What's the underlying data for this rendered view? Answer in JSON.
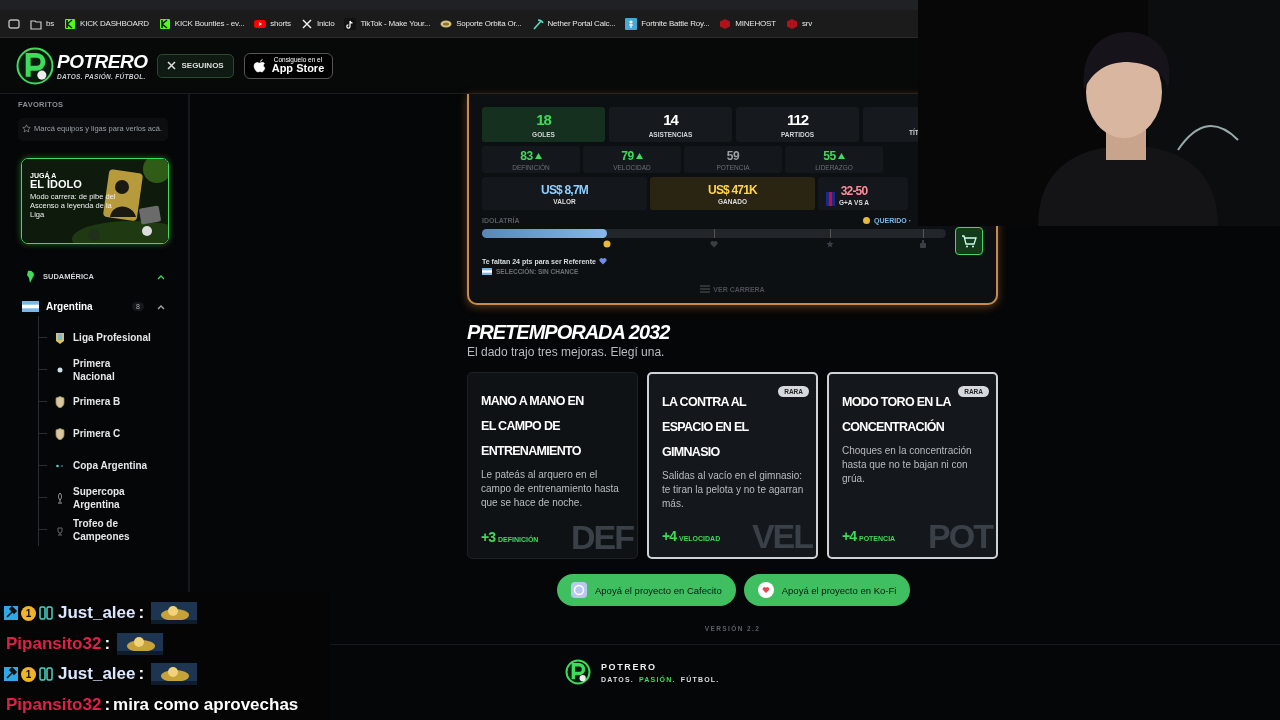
{
  "browser": {
    "bookmarks": [
      {
        "label": "bs"
      },
      {
        "label": "KICK DASHBOARD"
      },
      {
        "label": "KICK Bounties - ev..."
      },
      {
        "label": "shorts"
      },
      {
        "label": "Inicio"
      },
      {
        "label": "TikTok - Make Your..."
      },
      {
        "label": "Soporte Orbita Or..."
      },
      {
        "label": "Nether Portal Calc..."
      },
      {
        "label": "Fortnite Battle Roy..."
      },
      {
        "label": "MINEHOST"
      },
      {
        "label": "srv"
      }
    ]
  },
  "header": {
    "logo": {
      "name": "POTRERO",
      "tagline": "DATOS. PASIÓN. FÚTBOL."
    },
    "follow_button": "SEGUINOS",
    "app_store": {
      "small": "Consiguelo en el",
      "big": "App Store"
    }
  },
  "sidebar": {
    "favorites": {
      "title": "FAVORITOS",
      "hint": "Marcá equipos y ligas para verlos acá."
    },
    "promo": {
      "kicker": "JUGÁ A",
      "title": "EL ÍDOLO",
      "text": "Modo carrera: de pibe del Ascenso a leyenda de la Liga"
    },
    "regions": [
      {
        "name": "SUDAMÉRICA",
        "expanded": true,
        "children": [
          {
            "name": "Argentina",
            "count": "8",
            "expanded": true,
            "children": [
              {
                "name": "Liga Profesional"
              },
              {
                "name": "Primera Nacional"
              },
              {
                "name": "Primera B"
              },
              {
                "name": "Primera C"
              },
              {
                "name": "Copa Argentina"
              },
              {
                "name": "Supercopa Argentina"
              },
              {
                "name": "Trofeo de Campeones"
              }
            ]
          }
        ]
      }
    ]
  },
  "career": {
    "stats": [
      {
        "value": "18",
        "label": "GOLES",
        "highlighted": true
      },
      {
        "value": "14",
        "label": "ASISTENCIAS",
        "highlighted": false
      },
      {
        "value": "112",
        "label": "PARTIDOS",
        "highlighted": false
      },
      {
        "label": "TÍT",
        "highlighted": false
      }
    ],
    "attributes": [
      {
        "value": "83",
        "label": "DEFINICIÓN",
        "rising": true
      },
      {
        "value": "79",
        "label": "VELOCIDAD",
        "rising": true
      },
      {
        "value": "59",
        "label": "POTENCIA",
        "rising": false
      },
      {
        "value": "55",
        "label": "LIDERAZGO",
        "rising": true
      }
    ],
    "money": [
      {
        "value": "US$ 8,7M",
        "label": "VALOR"
      },
      {
        "value": "US$ 471K",
        "label": "GANADO"
      },
      {
        "value": "32-50",
        "label": "G+A VS A"
      }
    ],
    "idolatry": {
      "label": "IDOLATRÍA",
      "status": "QUERIDO ·",
      "level": 0.27
    },
    "next_level": "Te faltan 24 pts para ser Referente",
    "selection": "SELECCIÓN: SIN CHANCE",
    "link": "VER CARRERA"
  },
  "preseason": {
    "title": "PRETEMPORADA 2032",
    "subtitle": "El dado trajo tres mejoras. Elegí una.",
    "options": [
      {
        "title": "MANO A MANO EN EL CAMPO DE ENTRENAMIENTO",
        "rare": false,
        "text": "Le pateás al arquero en el campo de entrenamiento hasta que se hace de noche.",
        "bonus": "+3",
        "stat": "DEFINICIÓN",
        "watermark": "DEF"
      },
      {
        "title": "LA CONTRA AL ESPACIO EN EL GIMNASIO",
        "rare": true,
        "badge": "RARA",
        "text": "Salidas al vacío en el gimnasio: te tiran la pelota y no te agarran más.",
        "bonus": "+4",
        "stat": "VELOCIDAD",
        "watermark": "VEL"
      },
      {
        "title": "MODO TORO EN LA CONCENTRACIÓN",
        "rare": true,
        "badge": "RARA",
        "text": "Choques en la concentración hasta que no te bajan ni con grúa.",
        "bonus": "+4",
        "stat": "POTENCIA",
        "watermark": "POT"
      }
    ]
  },
  "support_buttons": [
    {
      "label": "Apoyá el proyecto en Cafecito"
    },
    {
      "label": "Apoyá el proyecto en Ko-Fi"
    }
  ],
  "version": "VERSIÓN 2.2",
  "footer": {
    "name": "POTRERO",
    "tagline": [
      {
        "text": "DATOS.",
        "accent": false
      },
      {
        "text": "PASIÓN.",
        "accent": true
      },
      {
        "text": "FÚTBOL.",
        "accent": false
      }
    ]
  },
  "stream": {
    "chat": [
      {
        "user": "Just_alee",
        "color": "#dce6ff",
        "badges": [
          {
            "kind": "mod"
          },
          {
            "kind": "tier",
            "label": "1"
          },
          {
            "kind": "gg"
          }
        ],
        "colon": ":",
        "kind": "emote"
      },
      {
        "user": "Pipansito32",
        "color": "#e0204a",
        "colon": ":",
        "kind": "emote"
      },
      {
        "user": "Just_alee",
        "color": "#dce6ff",
        "badges": [
          {
            "kind": "mod"
          },
          {
            "kind": "tier",
            "label": "1"
          },
          {
            "kind": "gg"
          }
        ],
        "colon": ":",
        "kind": "emote"
      },
      {
        "user": "Pipansito32",
        "color": "#e0204a",
        "colon": ":",
        "kind": "text",
        "text": "mira como aprovechas"
      }
    ]
  }
}
